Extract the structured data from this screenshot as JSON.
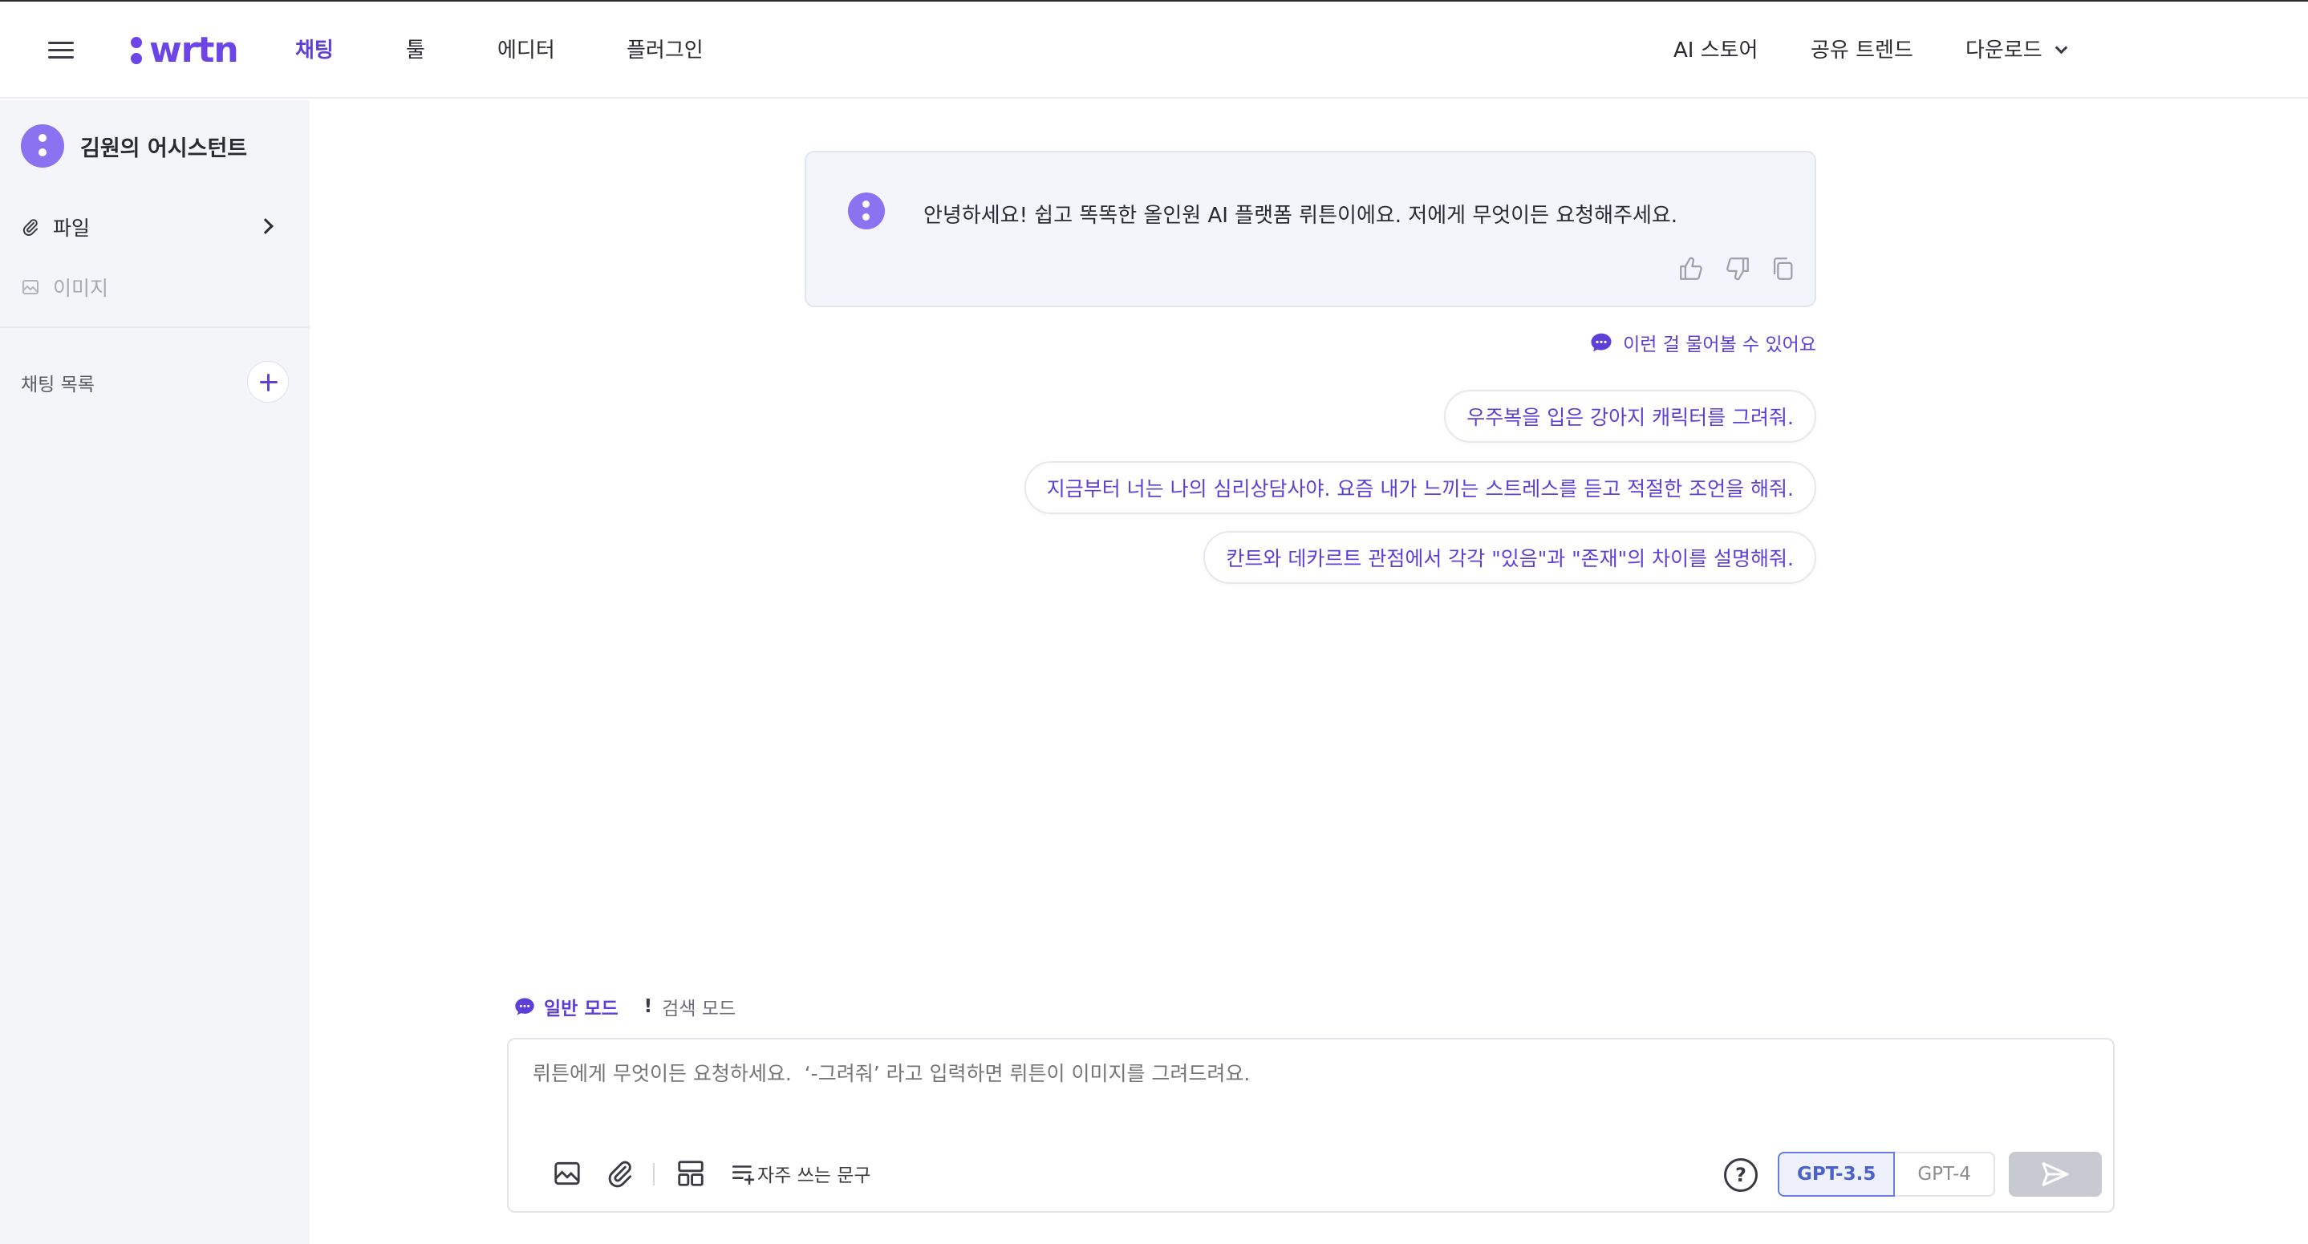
{
  "header": {
    "logo": "wrtn",
    "nav": [
      "채팅",
      "툴",
      "에디터",
      "플러그인"
    ],
    "right_nav": [
      "AI 스토어",
      "공유 트렌드",
      "다운로드"
    ]
  },
  "sidebar": {
    "assistant_name": "김원의 어시스턴트",
    "items": [
      {
        "label": "파일"
      },
      {
        "label": "이미지"
      }
    ],
    "chat_list_label": "채팅 목록"
  },
  "welcome": {
    "text": "안녕하세요! 쉽고 똑똑한 올인원 AI 플랫폼 뤼튼이에요. 저에게 무엇이든 요청해주세요."
  },
  "suggestions": {
    "heading": "이런 걸 물어볼 수 있어요",
    "items": [
      "우주복을 입은 강아지 캐릭터를 그려줘.",
      "지금부터 너는 나의 심리상담사야. 요즘 내가 느끼는 스트레스를 듣고 적절한 조언을 해줘.",
      "칸트와 데카르트 관점에서 각각 \"있음\"과 \"존재\"의 차이를 설명해줘."
    ]
  },
  "modes": {
    "normal": "일반 모드",
    "search": "검색 모드"
  },
  "composer": {
    "placeholder": "뤼튼에게 무엇이든 요청하세요.  ‘-그려줘’ 라고 입력하면 뤼튼이 이미지를 그려드려요.",
    "phrases_label": "자주 쓰는 문구",
    "help": "?",
    "models": [
      "GPT-3.5",
      "GPT-4"
    ],
    "selected_model": "GPT-3.5"
  },
  "colors": {
    "accent": "#5b3fd6",
    "logo": "#6b45e8",
    "sidebar_bg": "#f4f5f9"
  }
}
